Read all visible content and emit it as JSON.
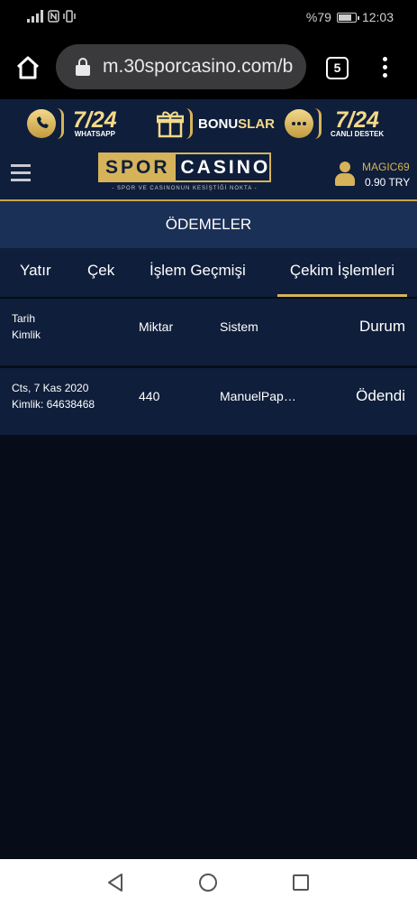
{
  "status_bar": {
    "battery_text": "%79",
    "battery_level": 0.79,
    "time": "12:03"
  },
  "browser": {
    "url": "m.30sporcasino.com/b",
    "tab_count": "5"
  },
  "promo": {
    "whatsapp_big": "7/24",
    "whatsapp_small": "WHATSAPP",
    "bonus_prefix": "BONU",
    "bonus_suffix": "SLAR",
    "support_big": "7/24",
    "support_small": "CANLI DESTEK"
  },
  "header": {
    "logo_left": "SPOR",
    "logo_right": "CASINO",
    "tagline": "- SPOR VE CASINONUN KESİŞTİĞİ NOKTA -",
    "username": "MAGIC69",
    "balance": "0.90 TRY"
  },
  "page": {
    "title": "ÖDEMELER"
  },
  "tabs": [
    {
      "label": "Yatır"
    },
    {
      "label": "Çek"
    },
    {
      "label": "İşlem Geçmişi"
    },
    {
      "label": "Çekim İşlemleri"
    }
  ],
  "table": {
    "headers": {
      "tarih": "Tarih",
      "kimlik": "Kimlik",
      "miktar": "Miktar",
      "sistem": "Sistem",
      "durum": "Durum"
    },
    "rows": [
      {
        "date": "Cts, 7 Kas 2020",
        "id": "Kimlik: 64638468",
        "amount": "440",
        "system": "ManuelPap…",
        "status": "Ödendi"
      }
    ]
  }
}
